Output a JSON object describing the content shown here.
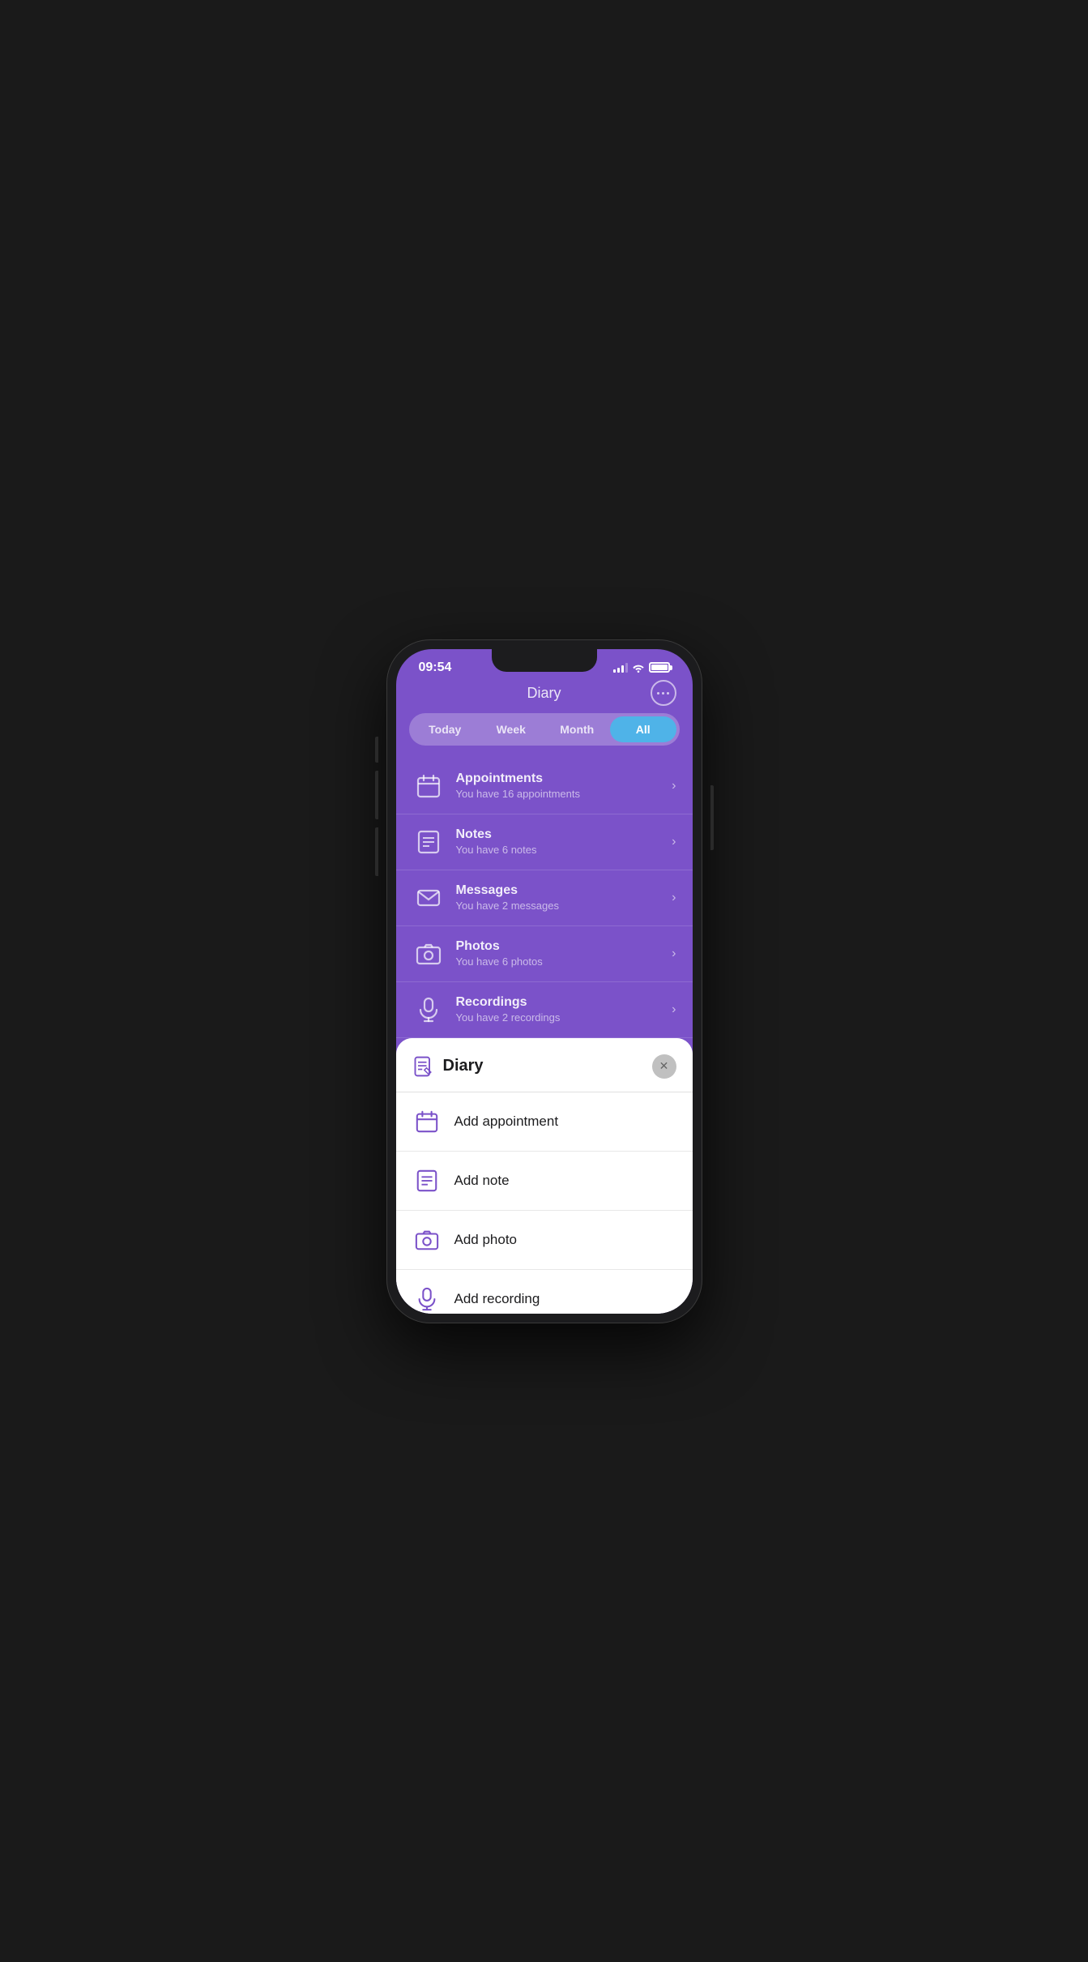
{
  "statusBar": {
    "time": "09:54"
  },
  "header": {
    "title": "Diary",
    "menuButtonLabel": "..."
  },
  "tabs": [
    {
      "id": "today",
      "label": "Today",
      "active": false
    },
    {
      "id": "week",
      "label": "Week",
      "active": false
    },
    {
      "id": "month",
      "label": "Month",
      "active": false
    },
    {
      "id": "all",
      "label": "All",
      "active": true
    }
  ],
  "menuItems": [
    {
      "id": "appointments",
      "title": "Appointments",
      "subtitle": "You have 16 appointments",
      "iconType": "calendar"
    },
    {
      "id": "notes",
      "title": "Notes",
      "subtitle": "You have 6 notes",
      "iconType": "notes"
    },
    {
      "id": "messages",
      "title": "Messages",
      "subtitle": "You have 2 messages",
      "iconType": "envelope"
    },
    {
      "id": "photos",
      "title": "Photos",
      "subtitle": "You have 6 photos",
      "iconType": "camera"
    },
    {
      "id": "recordings",
      "title": "Recordings",
      "subtitle": "You have 2 recordings",
      "iconType": "microphone"
    }
  ],
  "bottomSheet": {
    "title": "Diary",
    "closeButton": "×",
    "items": [
      {
        "id": "add-appointment",
        "label": "Add appointment",
        "iconType": "calendar"
      },
      {
        "id": "add-note",
        "label": "Add note",
        "iconType": "notes"
      },
      {
        "id": "add-photo",
        "label": "Add photo",
        "iconType": "camera"
      },
      {
        "id": "add-recording",
        "label": "Add recording",
        "iconType": "microphone"
      }
    ]
  },
  "colors": {
    "primary": "#7b52c9",
    "primaryLight": "#9b7dd4",
    "accentBlue": "#4fb3e8",
    "iconColor": "#7b52c9"
  }
}
